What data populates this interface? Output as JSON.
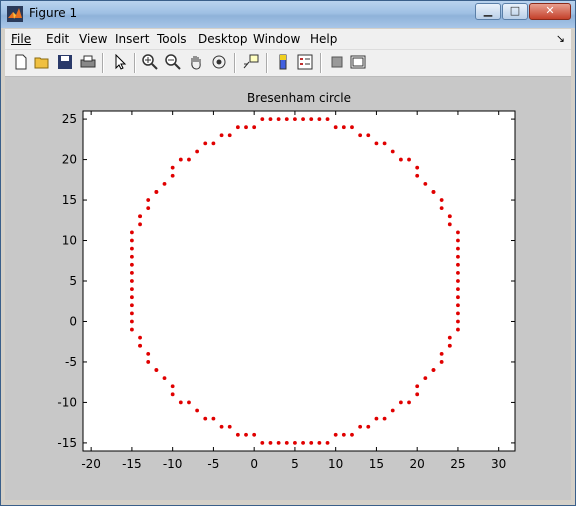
{
  "window": {
    "title": "Figure 1"
  },
  "menu": [
    "File",
    "Edit",
    "View",
    "Insert",
    "Tools",
    "Desktop",
    "Window",
    "Help"
  ],
  "toolbar": [
    "new-figure-icon",
    "open-file-icon",
    "save-icon",
    "print-icon",
    "edit-plot-arrow-icon",
    "zoom-in-icon",
    "zoom-out-icon",
    "pan-hand-icon",
    "rotate-3d-icon",
    "data-cursor-icon",
    "colorbar-icon",
    "legend-icon",
    "hide-plot-tools-icon",
    "show-plot-tools-icon"
  ],
  "colors": {
    "marker": "#e00000"
  },
  "chart_data": {
    "type": "scatter",
    "title": "Bresenham circle",
    "xlabel": "",
    "ylabel": "",
    "xlim": [
      -21,
      32
    ],
    "ylim": [
      -16,
      26
    ],
    "xticks": [
      -20,
      -15,
      -10,
      -5,
      0,
      5,
      10,
      15,
      20,
      25,
      30
    ],
    "yticks": [
      -15,
      -10,
      -5,
      0,
      5,
      10,
      15,
      20,
      25
    ],
    "marker": "dot",
    "center": [
      5,
      5
    ],
    "radius": 20,
    "x": [
      5,
      6,
      7,
      8,
      9,
      10,
      11,
      12,
      13,
      14,
      15,
      16,
      17,
      18,
      19,
      20,
      20,
      21,
      22,
      22,
      23,
      23,
      24,
      24,
      24,
      25,
      25,
      25,
      25,
      25,
      25,
      25,
      25,
      25,
      25,
      25,
      25,
      25,
      24,
      24,
      24,
      23,
      23,
      22,
      22,
      21,
      20,
      20,
      19,
      18,
      17,
      16,
      15,
      14,
      13,
      12,
      11,
      10,
      9,
      8,
      7,
      6,
      5,
      4,
      3,
      2,
      1,
      0,
      -1,
      -2,
      -3,
      -4,
      -5,
      -6,
      -7,
      -8,
      -9,
      -10,
      -10,
      -11,
      -12,
      -12,
      -13,
      -13,
      -14,
      -14,
      -14,
      -15,
      -15,
      -15,
      -15,
      -15,
      -15,
      -15,
      -15,
      -15,
      -15,
      -15,
      -15,
      -15,
      -14,
      -14,
      -14,
      -13,
      -13,
      -12,
      -12,
      -11,
      -10,
      -10,
      -9,
      -8,
      -7,
      -6,
      -5,
      -4,
      -3,
      -2,
      -1,
      0,
      1,
      2,
      3,
      4
    ],
    "y": [
      25,
      25,
      25,
      25,
      25,
      24,
      24,
      24,
      23,
      23,
      22,
      22,
      21,
      20,
      20,
      19,
      18,
      17,
      16,
      16,
      15,
      14,
      13,
      13,
      12,
      11,
      10,
      9,
      8,
      7,
      6,
      5,
      4,
      3,
      2,
      1,
      0,
      -1,
      -2,
      -3,
      -3,
      -4,
      -5,
      -6,
      -6,
      -7,
      -8,
      -9,
      -10,
      -10,
      -11,
      -12,
      -12,
      -13,
      -13,
      -14,
      -14,
      -14,
      -15,
      -15,
      -15,
      -15,
      -15,
      -15,
      -15,
      -15,
      -15,
      -14,
      -14,
      -14,
      -13,
      -13,
      -12,
      -12,
      -11,
      -10,
      -10,
      -9,
      -8,
      -7,
      -6,
      -6,
      -5,
      -4,
      -3,
      -3,
      -2,
      -1,
      0,
      1,
      2,
      3,
      4,
      5,
      6,
      7,
      8,
      9,
      10,
      11,
      12,
      13,
      13,
      14,
      15,
      16,
      16,
      17,
      18,
      19,
      20,
      20,
      21,
      22,
      22,
      23,
      23,
      24,
      24,
      24,
      25,
      25,
      25,
      25,
      25
    ]
  }
}
